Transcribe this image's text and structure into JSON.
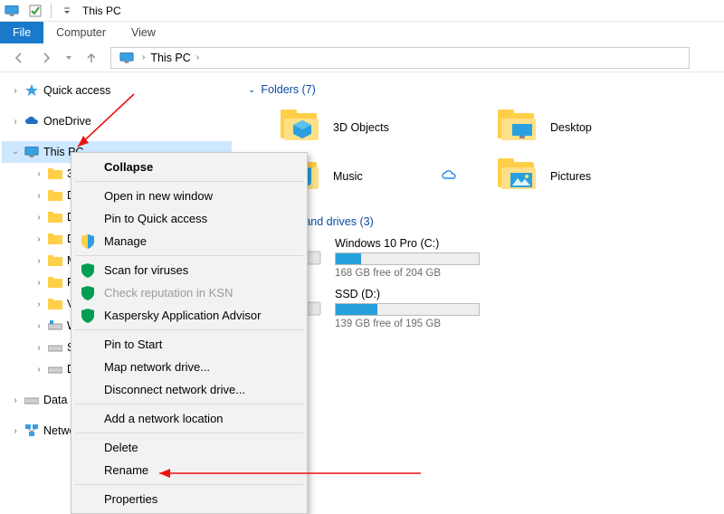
{
  "titlebar": {
    "title": "This PC"
  },
  "ribbon": {
    "file": "File",
    "tab_computer": "Computer",
    "tab_view": "View"
  },
  "address": {
    "crumb0": "This PC"
  },
  "tree": {
    "quick_access": "Quick access",
    "onedrive": "OneDrive",
    "this_pc": "This PC",
    "children": {
      "obj3d": "3D Objects",
      "desktop": "Desktop",
      "documents": "Documents",
      "downloads": "Downloads",
      "music": "Music",
      "pictures": "Pictures",
      "videos": "Videos",
      "drive_c": "Windows 10 Pro (C:)",
      "drive_d": "SSD (D:)",
      "drive_e": "Data (E:)"
    },
    "data": "Data (E:)",
    "network": "Network"
  },
  "content": {
    "group_folders": "Folders (7)",
    "group_drives": "Devices and drives (3)",
    "folders": {
      "obj3d": "3D Objects",
      "desktop": "Desktop",
      "music": "Music",
      "pictures": "Pictures"
    },
    "drives": {
      "c": {
        "name": "Windows 10 Pro (C:)",
        "free": "168 GB free of 204 GB",
        "fill_pct": 18
      },
      "d": {
        "name": "SSD (D:)",
        "free": "139 GB free of 195 GB",
        "fill_pct": 29
      }
    }
  },
  "ctx": {
    "collapse": "Collapse",
    "open_new": "Open in new window",
    "pin_qa": "Pin to Quick access",
    "manage": "Manage",
    "scan": "Scan for viruses",
    "ksn": "Check reputation in KSN",
    "kaa": "Kaspersky Application Advisor",
    "pin_start": "Pin to Start",
    "map_drive": "Map network drive...",
    "disc_drive": "Disconnect network drive...",
    "add_loc": "Add a network location",
    "delete": "Delete",
    "rename": "Rename",
    "properties": "Properties"
  }
}
